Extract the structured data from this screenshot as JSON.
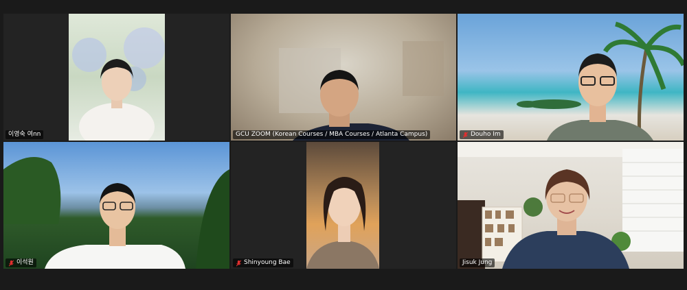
{
  "meeting": {
    "participants": [
      {
        "name": "이영숙 여nn",
        "muted": false,
        "active": false
      },
      {
        "name": "GCU ZOOM (Korean Courses / MBA Courses / Atlanta Campus)",
        "muted": false,
        "active": false
      },
      {
        "name": "Douho Im",
        "muted": true,
        "active": false
      },
      {
        "name": "이석원",
        "muted": true,
        "active": false
      },
      {
        "name": "Shinyoung Bae",
        "muted": true,
        "active": false
      },
      {
        "name": "Jisuk Jung",
        "muted": false,
        "active": true
      }
    ]
  },
  "colors": {
    "background": "#1a1a1a",
    "tile": "#232323",
    "active_speaker": "#1ed760",
    "muted_icon": "#e02f2f"
  },
  "icons": {
    "muted": "microphone-muted-icon"
  }
}
